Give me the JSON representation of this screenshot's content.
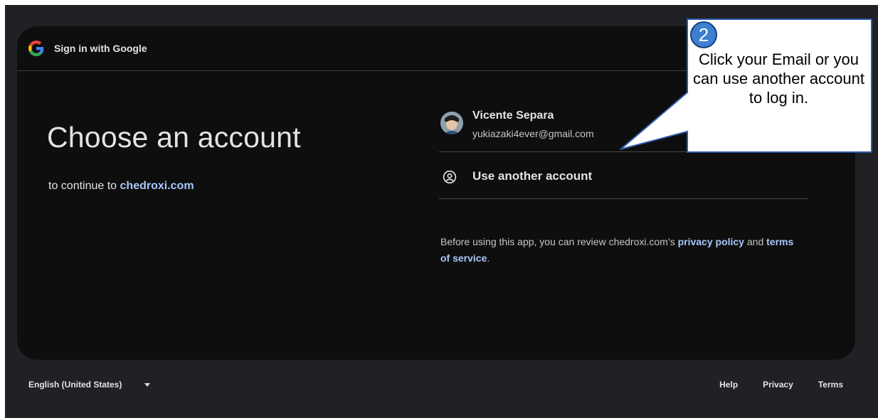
{
  "header": {
    "title": "Sign in with Google"
  },
  "main": {
    "headline": "Choose an account",
    "subline_prefix": "to continue to ",
    "site": "chedroxi.com"
  },
  "accounts": [
    {
      "name": "Vicente Separa",
      "email": "yukiazaki4ever@gmail.com"
    }
  ],
  "another_account": {
    "label": "Use another account"
  },
  "policy": {
    "prefix": "Before using this app, you can review chedroxi.com’s ",
    "privacy_link": "privacy policy",
    "middle": " and ",
    "terms_link": "terms of service",
    "suffix": "."
  },
  "footer": {
    "language": "English (United States)",
    "links": [
      "Help",
      "Privacy",
      "Terms"
    ]
  },
  "callout": {
    "step": "2",
    "text": "Click your Email or you can use another account to log in."
  },
  "colors": {
    "background": "#202124",
    "card": "#0e0e0f",
    "link": "#a8c7fa",
    "callout_border": "#2e5aa8",
    "badge": "#3d7fd1"
  },
  "icons": {
    "header": "google-g-icon",
    "another_account": "account-circle-icon",
    "language": "chevron-down-icon"
  }
}
